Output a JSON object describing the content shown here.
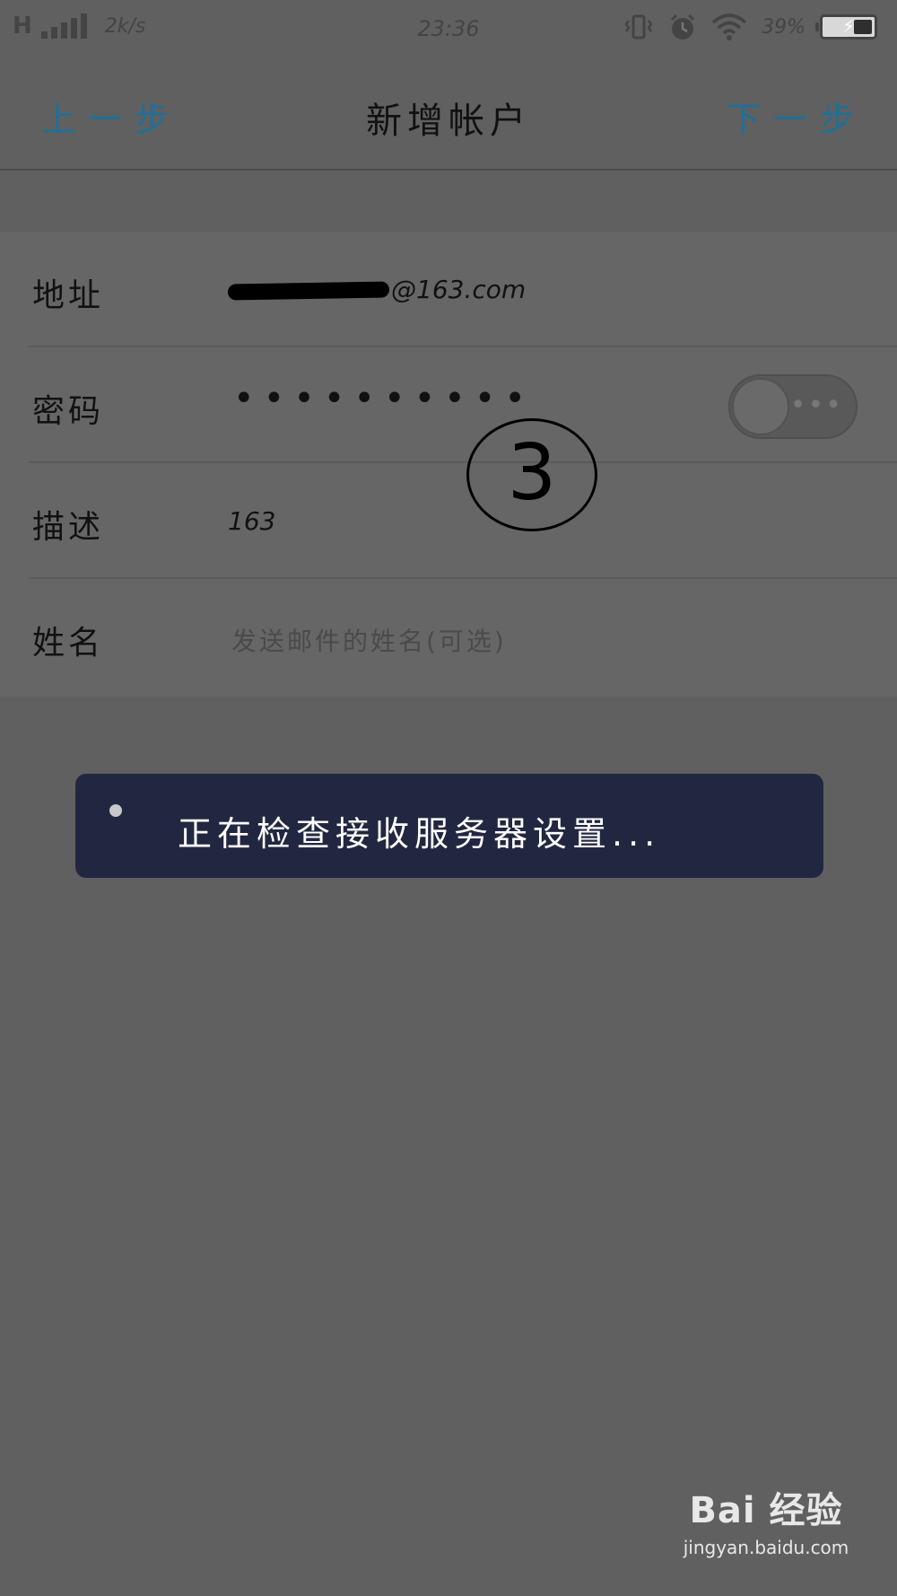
{
  "status_bar": {
    "network_type": "H",
    "speed": "2k/s",
    "time": "23:36",
    "battery": "39%",
    "battery_level": 0.39,
    "icons": [
      "signal-bars-icon",
      "vibrate-icon",
      "alarm-icon",
      "wifi-icon",
      "battery-charging-icon"
    ]
  },
  "header": {
    "prev_label": "上一步",
    "title": "新增帐户",
    "next_label": "下一步"
  },
  "form": {
    "address": {
      "label": "地址",
      "value": "@163.com"
    },
    "password": {
      "label": "密码",
      "value": "••••••••••",
      "toggle_on": false
    },
    "description": {
      "label": "描述",
      "value": "163"
    },
    "name": {
      "label": "姓名",
      "placeholder": "发送邮件的姓名(可选)"
    }
  },
  "annotation": {
    "label": "3"
  },
  "toast": {
    "message": "正在检查接收服务器设置..."
  },
  "watermark": {
    "brand": "Bai 经验",
    "url": "jingyan.baidu.com"
  },
  "colors": {
    "accent": "#1f6f98",
    "overlay": "#606060",
    "toast_bg": "#222741"
  }
}
